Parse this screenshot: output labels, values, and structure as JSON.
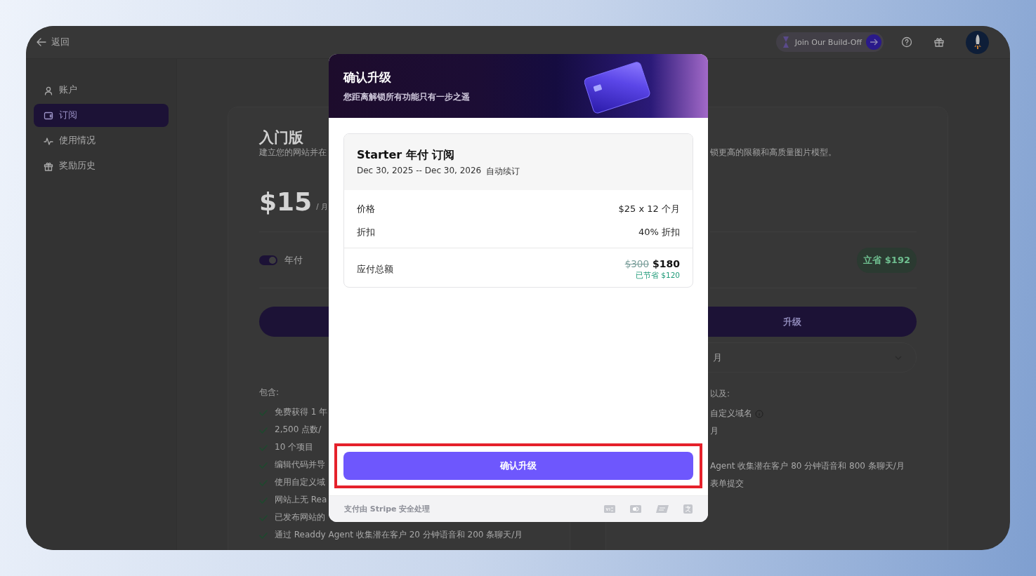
{
  "topbar": {
    "back": "返回",
    "promo": "Join Our Build-Off"
  },
  "sidebar": {
    "items": [
      {
        "label": "账户",
        "selected": false
      },
      {
        "label": "订阅",
        "selected": true
      },
      {
        "label": "使用情况",
        "selected": false
      },
      {
        "label": "奖励历史",
        "selected": false
      }
    ]
  },
  "plans": [
    {
      "title": "入门版",
      "description": "建立您的网站并在",
      "price": "$15",
      "period": "/ 月",
      "billing": {
        "label": "年付",
        "on": true
      },
      "includes_label": "包含:",
      "features": [
        {
          "text": "免费获得 1 年",
          "info": false
        },
        {
          "text": "2,500 点数/",
          "info": false
        },
        {
          "text": "10 个项目",
          "info": false
        },
        {
          "text": "编辑代码并导",
          "info": false
        },
        {
          "text": "使用自定义域",
          "info": false
        },
        {
          "text": "网站上无 Rea",
          "info": false
        },
        {
          "text": "已发布网站的",
          "info": false
        },
        {
          "text": "通过 Readdy Agent 收集潜在客户 20 分钟语音和 200 条聊天/月",
          "info": false
        }
      ]
    },
    {
      "description": "锁更高的限额和高质量图片模型。",
      "savings_badge": "立省 $192",
      "button": "升级",
      "select_value": "月",
      "includes_label": "以及:",
      "features": [
        {
          "text": "自定义域名",
          "info": true
        },
        {
          "text": "月",
          "info": false
        },
        {
          "text": "Agent 收集潜在客户 80 分钟语音和 800 条聊天/月",
          "info": false
        },
        {
          "text": "表单提交",
          "info": false
        }
      ]
    }
  ],
  "modal": {
    "title": "确认升级",
    "subtitle": "您距离解锁所有功能只有一步之遥",
    "summary": {
      "plan": "Starter 年付 订阅",
      "period": "Dec 30, 2025 -- Dec 30, 2026",
      "renewal": "自动续订",
      "rows": [
        {
          "label": "价格",
          "value": "$25 x 12 个月"
        },
        {
          "label": "折扣",
          "value": "40% 折扣"
        }
      ],
      "total": {
        "label": "应付总额",
        "original": "$300",
        "amount": "$180",
        "saved": "已节省 $120"
      }
    },
    "confirm": {
      "label": "确认升级",
      "highlighted": true
    },
    "footer": "支付由 Stripe 安全处理"
  }
}
